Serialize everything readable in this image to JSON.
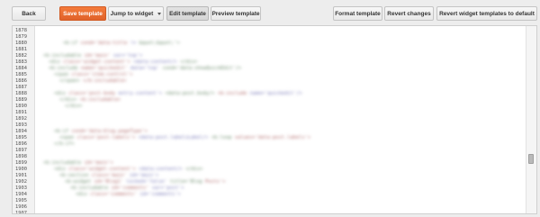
{
  "toolbar": {
    "back": "Back",
    "save_template": "Save template",
    "jump_to_widget": "Jump to widget",
    "edit_template": "Edit template",
    "preview_template": "Preview template",
    "format_template": "Format template",
    "revert_changes": "Revert changes",
    "revert_widget_templates": "Revert widget templates to default"
  },
  "colors": {
    "primary_button": "#f47b3b",
    "editor_background": "#ffffff",
    "toolbar_background": "#ededed"
  },
  "editor": {
    "line_numbers": [
      "1878",
      "1879",
      "1880",
      "1881",
      "1882",
      "1883",
      "1884",
      "1885",
      "1886",
      "1887",
      "1888",
      "1889",
      "1890",
      "1891",
      "1892",
      "1893",
      "1894",
      "1895",
      "1896",
      "1897",
      "1898",
      "1899",
      "1900",
      "1901",
      "1902",
      "1903",
      "1904",
      "1905",
      "1906",
      "1907"
    ],
    "scroll_position_fraction": 0.72
  }
}
